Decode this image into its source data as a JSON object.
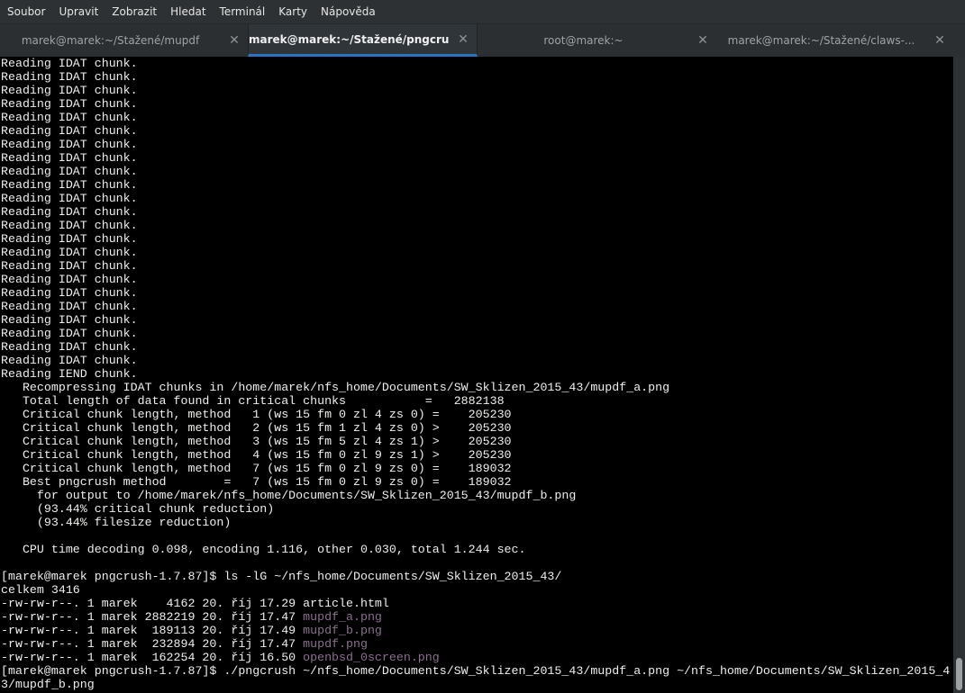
{
  "menu": [
    "Soubor",
    "Upravit",
    "Zobrazit",
    "Hledat",
    "Terminál",
    "Karty",
    "Nápověda"
  ],
  "tabs": [
    {
      "label": "marek@marek:~/Stažené/mupdf",
      "close": "✕",
      "active": false
    },
    {
      "label": "marek@marek:~/Stažené/pngcrus...",
      "close": "✕",
      "active": true
    },
    {
      "label": "root@marek:~",
      "close": "✕",
      "active": false
    },
    {
      "label": "marek@marek:~/Stažené/claws-...",
      "close": "✕",
      "active": false
    }
  ],
  "colors": {
    "accent": "#2a72c4",
    "file_png": "#8a6f8e",
    "text": "#eeeeec"
  },
  "lines": [
    [
      {
        "t": "Reading IDAT chunk."
      }
    ],
    [
      {
        "t": "Reading IDAT chunk."
      }
    ],
    [
      {
        "t": "Reading IDAT chunk."
      }
    ],
    [
      {
        "t": "Reading IDAT chunk."
      }
    ],
    [
      {
        "t": "Reading IDAT chunk."
      }
    ],
    [
      {
        "t": "Reading IDAT chunk."
      }
    ],
    [
      {
        "t": "Reading IDAT chunk."
      }
    ],
    [
      {
        "t": "Reading IDAT chunk."
      }
    ],
    [
      {
        "t": "Reading IDAT chunk."
      }
    ],
    [
      {
        "t": "Reading IDAT chunk."
      }
    ],
    [
      {
        "t": "Reading IDAT chunk."
      }
    ],
    [
      {
        "t": "Reading IDAT chunk."
      }
    ],
    [
      {
        "t": "Reading IDAT chunk."
      }
    ],
    [
      {
        "t": "Reading IDAT chunk."
      }
    ],
    [
      {
        "t": "Reading IDAT chunk."
      }
    ],
    [
      {
        "t": "Reading IDAT chunk."
      }
    ],
    [
      {
        "t": "Reading IDAT chunk."
      }
    ],
    [
      {
        "t": "Reading IDAT chunk."
      }
    ],
    [
      {
        "t": "Reading IDAT chunk."
      }
    ],
    [
      {
        "t": "Reading IDAT chunk."
      }
    ],
    [
      {
        "t": "Reading IDAT chunk."
      }
    ],
    [
      {
        "t": "Reading IDAT chunk."
      }
    ],
    [
      {
        "t": "Reading IDAT chunk."
      }
    ],
    [
      {
        "t": "Reading IEND chunk."
      }
    ],
    [
      {
        "t": "   Recompressing IDAT chunks in /home/marek/nfs_home/Documents/SW_Sklizen_2015_43/mupdf_a.png"
      }
    ],
    [
      {
        "t": "   Total length of data found in critical chunks           =   2882138"
      }
    ],
    [
      {
        "t": "   Critical chunk length, method   1 (ws 15 fm 0 zl 4 zs 0) =    205230"
      }
    ],
    [
      {
        "t": "   Critical chunk length, method   2 (ws 15 fm 1 zl 4 zs 0) >    205230"
      }
    ],
    [
      {
        "t": "   Critical chunk length, method   3 (ws 15 fm 5 zl 4 zs 1) >    205230"
      }
    ],
    [
      {
        "t": "   Critical chunk length, method   4 (ws 15 fm 0 zl 9 zs 1) >    205230"
      }
    ],
    [
      {
        "t": "   Critical chunk length, method   7 (ws 15 fm 0 zl 9 zs 0) =    189032"
      }
    ],
    [
      {
        "t": "   Best pngcrush method        =   7 (ws 15 fm 0 zl 9 zs 0) =    189032"
      }
    ],
    [
      {
        "t": "     for output to /home/marek/nfs_home/Documents/SW_Sklizen_2015_43/mupdf_b.png"
      }
    ],
    [
      {
        "t": "     (93.44% critical chunk reduction)"
      }
    ],
    [
      {
        "t": "     (93.44% filesize reduction)"
      }
    ],
    [
      {
        "t": ""
      }
    ],
    [
      {
        "t": "   CPU time decoding 0.098, encoding 1.116, other 0.030, total 1.244 sec."
      }
    ],
    [
      {
        "t": ""
      }
    ],
    [
      {
        "t": "[marek@marek pngcrush-1.7.87]$ ls -lG ~/nfs_home/Documents/SW_Sklizen_2015_43/"
      }
    ],
    [
      {
        "t": "celkem 3416"
      }
    ],
    [
      {
        "t": "-rw-rw-r--. 1 marek    4162 20. říj 17.29 "
      },
      {
        "t": "article.html"
      }
    ],
    [
      {
        "t": "-rw-rw-r--. 1 marek 2882219 20. říj 17.47 "
      },
      {
        "t": "mupdf_a.png",
        "c": "purple"
      }
    ],
    [
      {
        "t": "-rw-rw-r--. 1 marek  189113 20. říj 17.49 "
      },
      {
        "t": "mupdf_b.png",
        "c": "purple"
      }
    ],
    [
      {
        "t": "-rw-rw-r--. 1 marek  232894 20. říj 17.47 "
      },
      {
        "t": "mupdf.png",
        "c": "purple"
      }
    ],
    [
      {
        "t": "-rw-rw-r--. 1 marek  162254 20. říj 16.50 "
      },
      {
        "t": "openbsd_0screen.png",
        "c": "purple"
      }
    ],
    [
      {
        "t": "[marek@marek pngcrush-1.7.87]$ ./pngcrush ~/nfs_home/Documents/SW_Sklizen_2015_43/mupdf_a.png ~/nfs_home/Documents/SW_Sklizen_2015_4"
      }
    ],
    [
      {
        "t": "3/mupdf_b.png"
      }
    ]
  ]
}
